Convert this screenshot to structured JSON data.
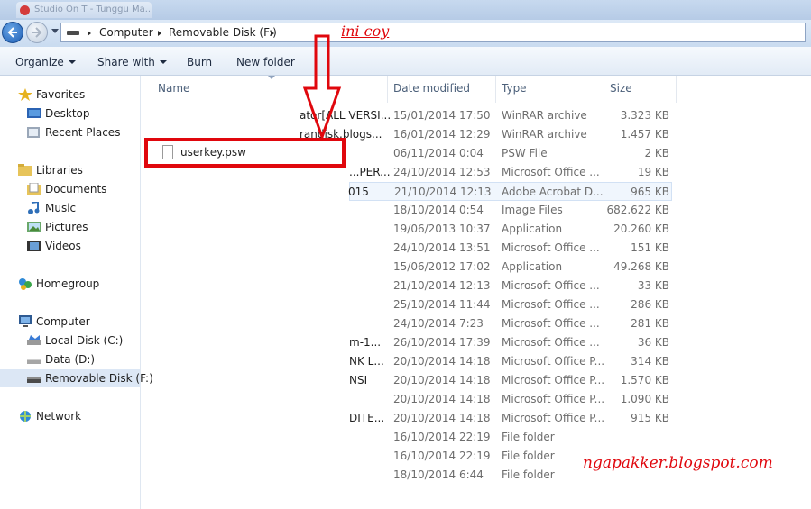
{
  "window": {
    "tab_title": "Studio On T - Tunggu Ma..."
  },
  "address": {
    "crumbs": [
      "Computer",
      "Removable Disk (F:)"
    ]
  },
  "toolbar": {
    "organize": "Organize",
    "share_with": "Share with",
    "burn": "Burn",
    "new_folder": "New folder"
  },
  "sidebar": {
    "favorites": "Favorites",
    "desktop": "Desktop",
    "recent_places": "Recent Places",
    "libraries": "Libraries",
    "documents": "Documents",
    "music": "Music",
    "pictures": "Pictures",
    "videos": "Videos",
    "homegroup": "Homegroup",
    "computer": "Computer",
    "local_disk": "Local Disk (C:)",
    "data": "Data  (D:)",
    "removable_disk": "Removable Disk (F:)",
    "network": "Network"
  },
  "columns": {
    "name": "Name",
    "date": "Date modified",
    "type": "Type",
    "size": "Size"
  },
  "files": [
    {
      "name": "ator[ALL VERSI...",
      "date": "15/01/2014 17:50",
      "type": "WinRAR archive",
      "size": "3.323 KB"
    },
    {
      "name": "randisk.blogs...",
      "date": "16/01/2014 12:29",
      "type": "WinRAR archive",
      "size": "1.457 KB"
    },
    {
      "name": "userkey.psw",
      "date": "06/11/2014 0:04",
      "type": "PSW File",
      "size": "2 KB"
    },
    {
      "name": "...PER...",
      "date": "24/10/2014 12:53",
      "type": "Microsoft Office ...",
      "size": "19 KB"
    },
    {
      "name": "015",
      "date": "21/10/2014 12:13",
      "type": "Adobe Acrobat D...",
      "size": "965 KB"
    },
    {
      "name": "",
      "date": "18/10/2014 0:54",
      "type": "Image Files",
      "size": "682.622 KB"
    },
    {
      "name": "",
      "date": "19/06/2013 10:37",
      "type": "Application",
      "size": "20.260 KB"
    },
    {
      "name": "",
      "date": "24/10/2014 13:51",
      "type": "Microsoft Office ...",
      "size": "151 KB"
    },
    {
      "name": "",
      "date": "15/06/2012 17:02",
      "type": "Application",
      "size": "49.268 KB"
    },
    {
      "name": "",
      "date": "21/10/2014 12:13",
      "type": "Microsoft Office ...",
      "size": "33 KB"
    },
    {
      "name": "",
      "date": "25/10/2014 11:44",
      "type": "Microsoft Office ...",
      "size": "286 KB"
    },
    {
      "name": "",
      "date": "24/10/2014 7:23",
      "type": "Microsoft Office ...",
      "size": "281 KB"
    },
    {
      "name": "m-1...",
      "date": "26/10/2014 17:39",
      "type": "Microsoft Office ...",
      "size": "36 KB"
    },
    {
      "name": "NK L...",
      "date": "20/10/2014 14:18",
      "type": "Microsoft Office P...",
      "size": "314 KB"
    },
    {
      "name": "NSI",
      "date": "20/10/2014 14:18",
      "type": "Microsoft Office P...",
      "size": "1.570 KB"
    },
    {
      "name": "",
      "date": "20/10/2014 14:18",
      "type": "Microsoft Office P...",
      "size": "1.090 KB"
    },
    {
      "name": "DITE...",
      "date": "20/10/2014 14:18",
      "type": "Microsoft Office P...",
      "size": "915 KB"
    },
    {
      "name": "",
      "date": "16/10/2014 22:19",
      "type": "File folder",
      "size": ""
    },
    {
      "name": "",
      "date": "16/10/2014 22:19",
      "type": "File folder",
      "size": ""
    },
    {
      "name": "",
      "date": "18/10/2014 6:44",
      "type": "File folder",
      "size": ""
    }
  ],
  "annotation": {
    "note": "ini coy",
    "watermark": "ngapakker.blogspot.com"
  },
  "colors": {
    "highlight": "#e0070d",
    "selection": "#dce7f5"
  }
}
